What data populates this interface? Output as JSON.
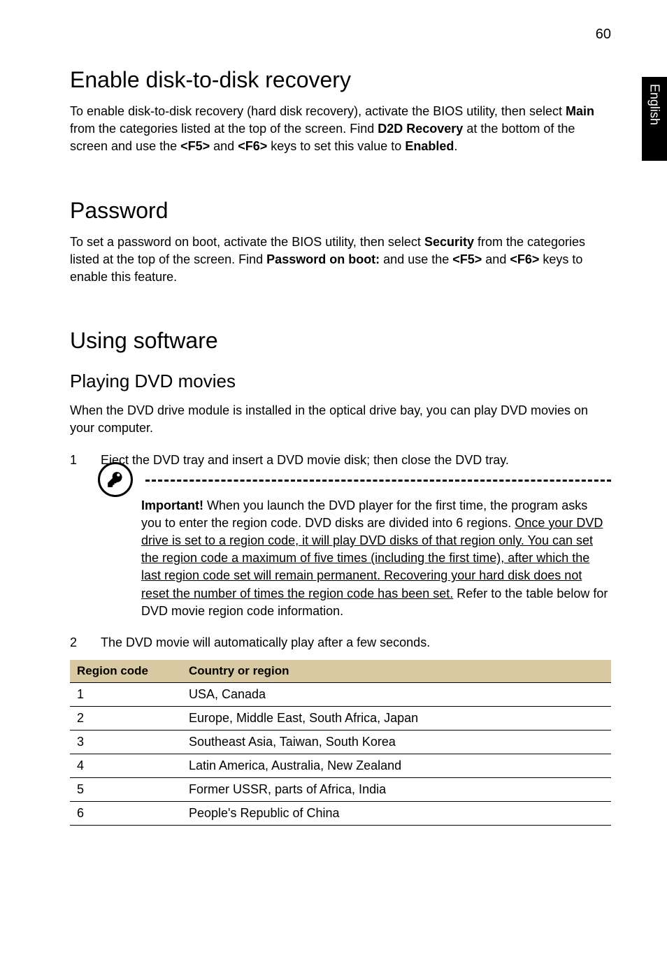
{
  "page_number": "60",
  "side_tab": "English",
  "section_enable": {
    "heading": "Enable disk-to-disk recovery",
    "para_parts": {
      "p1": "To enable disk-to-disk recovery (hard disk recovery), activate the BIOS utility, then select ",
      "main": "Main",
      "p2": " from the categories listed at the top of the screen. Find ",
      "d2d": "D2D Recovery",
      "p3": " at the bottom of the screen and use the ",
      "f5": "<F5>",
      "and1": " and ",
      "f6": "<F6>",
      "p4": " keys to set this value to ",
      "enabled": "Enabled",
      "p5": "."
    }
  },
  "section_password": {
    "heading": "Password",
    "para_parts": {
      "p1": "To set a password on boot, activate the BIOS utility, then select ",
      "security": "Security",
      "p2": " from the categories listed at the top of the screen. Find ",
      "pob": "Password on boot:",
      "p3": " and use the ",
      "f5": "<F5>",
      "and1": " and ",
      "f6": "<F6>",
      "p4": " keys to enable this feature."
    }
  },
  "section_software": {
    "heading": "Using software",
    "sub_heading": "Playing DVD movies",
    "intro": "When the DVD drive module is installed in the optical drive bay, you can play DVD movies on your computer.",
    "step1_num": "1",
    "step1_text": "Eject the DVD tray and insert a DVD movie disk; then close the DVD tray.",
    "note": {
      "important_label": "Important!",
      "pre": " When you launch the DVD player for the first time, the program asks you to enter the region code. DVD disks are divided into 6 regions. ",
      "underlined": "Once your DVD drive is set to a region code, it will play DVD disks of that region only. You can set the region code a maximum of five times (including the first time), after which the last region code set will remain permanent. Recovering your hard disk does not reset the number of times the region code has been set.",
      "post": " Refer to the table below for DVD movie region code information."
    },
    "step2_num": "2",
    "step2_text": "The DVD movie will automatically play after a few seconds.",
    "table": {
      "headers": {
        "code": "Region code",
        "region": "Country or region"
      },
      "rows": [
        {
          "code": "1",
          "region": "USA, Canada"
        },
        {
          "code": "2",
          "region": "Europe, Middle East, South Africa, Japan"
        },
        {
          "code": "3",
          "region": "Southeast Asia, Taiwan, South Korea"
        },
        {
          "code": "4",
          "region": "Latin America, Australia, New Zealand"
        },
        {
          "code": "5",
          "region": "Former USSR, parts of Africa, India"
        },
        {
          "code": "6",
          "region": "People's Republic of China"
        }
      ]
    }
  }
}
